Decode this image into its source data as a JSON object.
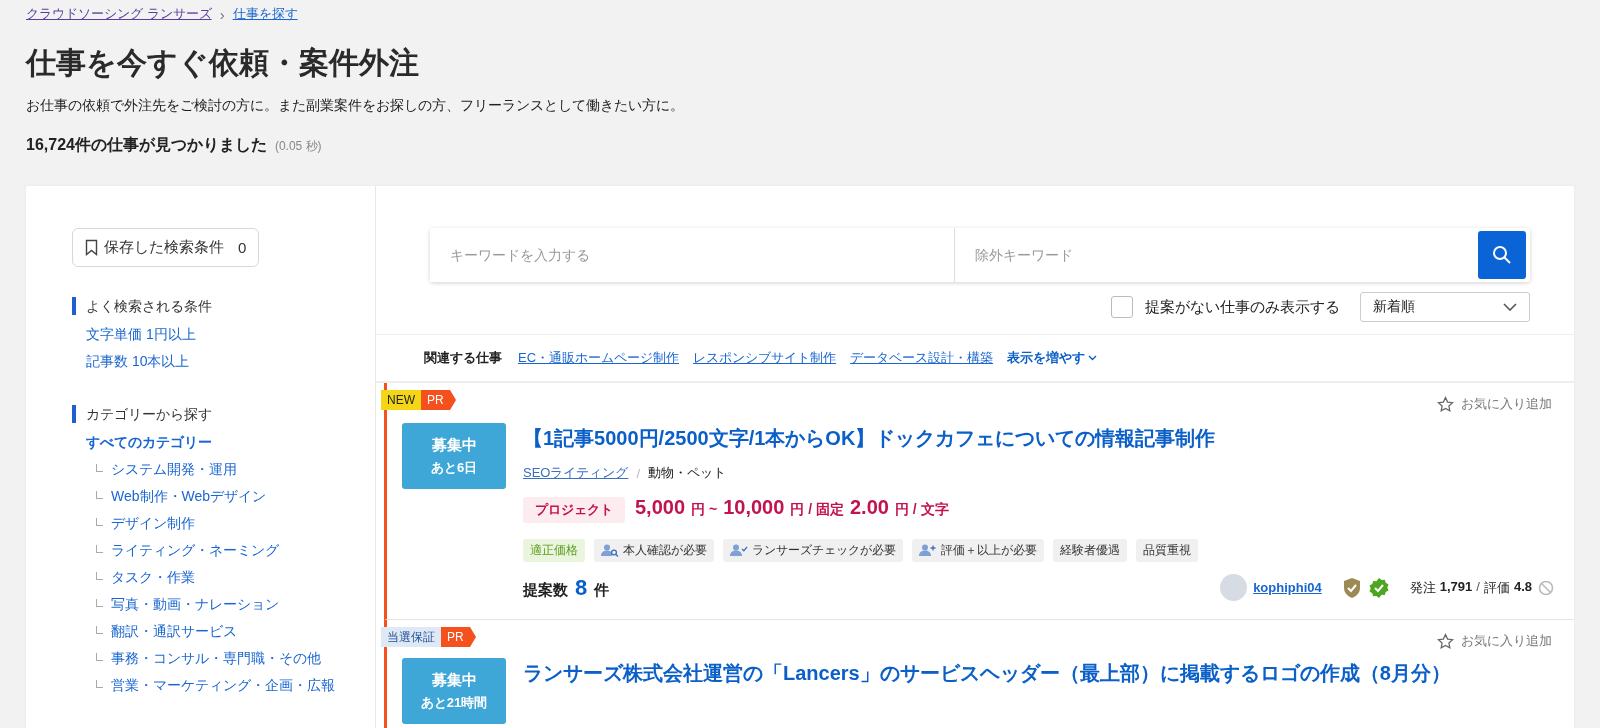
{
  "breadcrumb": {
    "separator": "›",
    "items": [
      {
        "label": "クラウドソーシング ランサーズ",
        "visited": true
      },
      {
        "label": "仕事を探す",
        "visited": false
      }
    ]
  },
  "title": "仕事を今すぐ依頼・案件外注",
  "description": "お仕事の依頼で外注先をご検討の方に。また副業案件をお探しの方、フリーランスとして働きたい方に。",
  "result": {
    "count": "16,724件の仕事が見つかりました",
    "time": "(0.05 秒)"
  },
  "sidebar": {
    "saved_search": {
      "label": "保存した検索条件",
      "count": "0"
    },
    "popular": {
      "heading": "よく検索される条件",
      "items": [
        "文字単価 1円以上",
        "記事数 10本以上"
      ]
    },
    "categories": {
      "heading": "カテゴリーから探す",
      "tree": {
        "label": "すべてのカテゴリー",
        "children": [
          {
            "label": "システム開発・運用"
          },
          {
            "label": "Web制作・Webデザイン"
          },
          {
            "label": "デザイン制作"
          },
          {
            "label": "ライティング・ネーミング"
          },
          {
            "label": "タスク・作業"
          },
          {
            "label": "写真・動画・ナレーション"
          },
          {
            "label": "翻訳・通訳サービス"
          },
          {
            "label": "事務・コンサル・専門職・その他"
          },
          {
            "label": "営業・マーケティング・企画・広報"
          }
        ]
      }
    }
  },
  "search": {
    "keyword_placeholder": "キーワードを入力する",
    "exclude_placeholder": "除外キーワード",
    "no_proposals_only": {
      "label": "提案がない仕事のみ表示する",
      "checked": false
    },
    "sort": "新着順"
  },
  "related": {
    "label": "関連する仕事",
    "links": [
      "EC・通販ホームページ制作",
      "レスポンシブサイト制作",
      "データベース設計・構築"
    ],
    "more": "表示を増やす"
  },
  "jobs": [
    {
      "flags": [
        {
          "label": "NEW",
          "kind": "new"
        },
        {
          "label": "PR",
          "kind": "pr"
        }
      ],
      "status": "募集中",
      "remaining": "あと6日",
      "favorite": "お気に入り追加",
      "title": "【1記事5000円/2500文字/1本からOK】ドックカフェについての情報記事制作",
      "category": "SEOライティング",
      "category_divider": "/",
      "subcategory": "動物・ペット",
      "type": "プロジェクト",
      "price": [
        {
          "text": "5,000",
          "kind": "amount"
        },
        {
          "text": "円 ~",
          "kind": "unit"
        },
        {
          "text": "10,000",
          "kind": "amount"
        },
        {
          "text": "円 / 固定",
          "kind": "unit"
        },
        {
          "text": "2.00",
          "kind": "amount"
        },
        {
          "text": "円 / 文字",
          "kind": "unit"
        }
      ],
      "tags": [
        {
          "label": "適正価格",
          "kind": "highlight"
        },
        {
          "label": "本人確認が必要",
          "kind": "identity"
        },
        {
          "label": "ランサーズチェックが必要",
          "kind": "check"
        },
        {
          "label": "評価＋以上が必要",
          "kind": "rating"
        },
        {
          "label": "経験者優遇",
          "kind": "plain"
        },
        {
          "label": "品質重視",
          "kind": "plain"
        }
      ],
      "proposals": {
        "label": "提案数",
        "count": "8",
        "unit": "件"
      },
      "client": {
        "name": "kophiphi04",
        "orders_label": "発注",
        "orders": "1,791",
        "divider": "/",
        "rating_label": "評価",
        "rating": "4.8"
      }
    },
    {
      "flags": [
        {
          "label": "当選保証",
          "kind": "guarantee"
        },
        {
          "label": "PR",
          "kind": "pr"
        }
      ],
      "status": "募集中",
      "remaining": "あと21時間",
      "favorite": "お気に入り追加",
      "title": "ランサーズ株式会社運営の「Lancers」のサービスヘッダー（最上部）に掲載するロゴの作成（8月分）"
    }
  ]
}
